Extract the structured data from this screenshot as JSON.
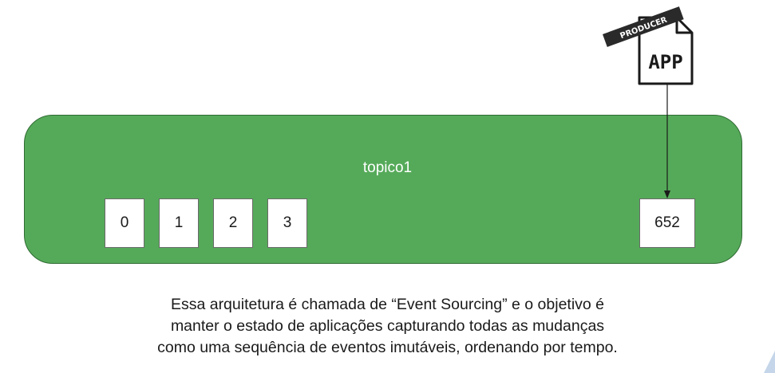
{
  "producer": {
    "badge": "PRODUCER",
    "label": "APP",
    "icon": "document-icon"
  },
  "topic": {
    "name": "topico1",
    "color": "#55aa59",
    "offsets": [
      "0",
      "1",
      "2",
      "3",
      "652"
    ]
  },
  "caption": {
    "line1": "Essa arquitetura é chamada de “Event Sourcing” e o objetivo é",
    "line2": "manter o estado de aplicações capturando todas as mudanças",
    "line3": "como uma sequência de eventos imutáveis, ordenando por tempo."
  }
}
